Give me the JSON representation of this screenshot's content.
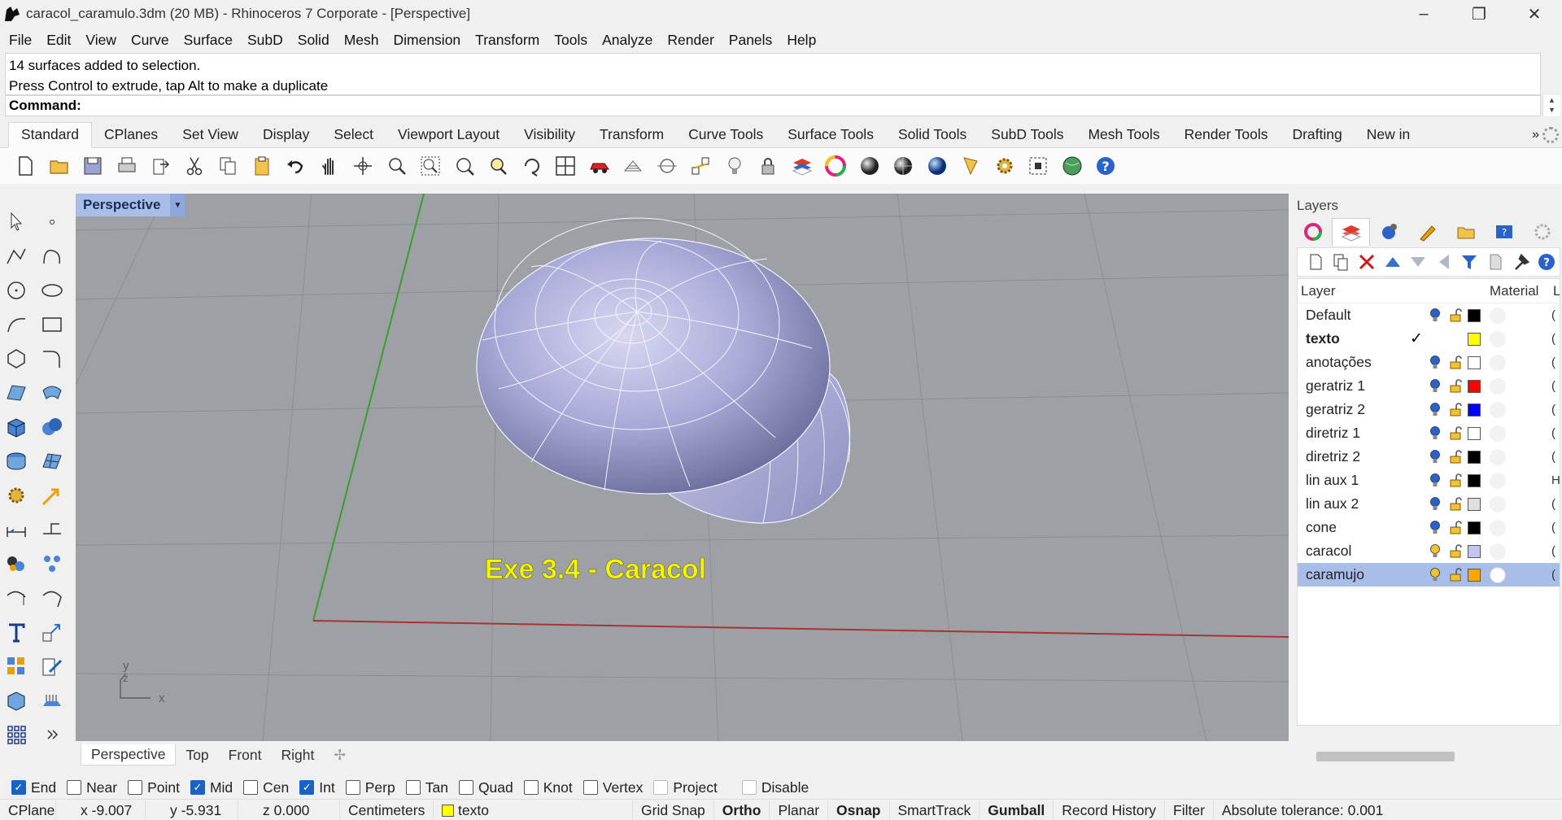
{
  "window": {
    "title": "caracol_caramulo.3dm (20 MB) - Rhinoceros 7 Corporate - [Perspective]",
    "minimize": "–",
    "restore": "❐",
    "close": "✕"
  },
  "menu": [
    "File",
    "Edit",
    "View",
    "Curve",
    "Surface",
    "SubD",
    "Solid",
    "Mesh",
    "Dimension",
    "Transform",
    "Tools",
    "Analyze",
    "Render",
    "Panels",
    "Help"
  ],
  "command": {
    "history": [
      "14 surfaces added to selection.",
      "Press Control to extrude, tap Alt to make a duplicate"
    ],
    "prompt": "Command:"
  },
  "toolbar_tabs": [
    "Standard",
    "CPlanes",
    "Set View",
    "Display",
    "Select",
    "Viewport Layout",
    "Visibility",
    "Transform",
    "Curve Tools",
    "Surface Tools",
    "Solid Tools",
    "SubD Tools",
    "Mesh Tools",
    "Render Tools",
    "Drafting",
    "New in"
  ],
  "toolbar_more": "»",
  "viewport": {
    "name": "Perspective",
    "dropdown": "▼",
    "annotation_text": "Exe 3.4 - Caracol",
    "axis_x": "x",
    "axis_y": "y",
    "axis_z": "z",
    "annotation_color": "#f5f500",
    "shell_color": "#a9a9d8"
  },
  "viewport_tabs": [
    "Perspective",
    "Top",
    "Front",
    "Right"
  ],
  "viewport_tab_add": "✢",
  "layers_panel": {
    "title": "Layers",
    "columns": {
      "layer": "Layer",
      "material": "Material",
      "extra": "L"
    },
    "rows": [
      {
        "name": "Default",
        "current": false,
        "color": "#000000",
        "bulb": "on",
        "end": "("
      },
      {
        "name": "texto",
        "current": true,
        "color": "#ffff00",
        "bulb": "none",
        "end": "("
      },
      {
        "name": "anotações",
        "current": false,
        "color": "#ffffff",
        "bulb": "on",
        "end": "("
      },
      {
        "name": "geratriz 1",
        "current": false,
        "color": "#ff0000",
        "bulb": "on",
        "end": "("
      },
      {
        "name": "geratriz 2",
        "current": false,
        "color": "#0000ff",
        "bulb": "on",
        "end": "("
      },
      {
        "name": "diretriz 1",
        "current": false,
        "color": "#ffffff",
        "bulb": "on",
        "end": "("
      },
      {
        "name": "diretriz 2",
        "current": false,
        "color": "#000000",
        "bulb": "on",
        "end": "("
      },
      {
        "name": "lin aux 1",
        "current": false,
        "color": "#000000",
        "bulb": "on",
        "end": "H"
      },
      {
        "name": "lin aux 2",
        "current": false,
        "color": "#e0e0e0",
        "bulb": "on",
        "end": "("
      },
      {
        "name": "cone",
        "current": false,
        "color": "#000000",
        "bulb": "on",
        "end": "("
      },
      {
        "name": "caracol",
        "current": false,
        "color": "#c4c4f4",
        "bulb": "off",
        "end": "("
      },
      {
        "name": "caramujo",
        "current": false,
        "color": "#ffa500",
        "bulb": "off",
        "end": "(",
        "selected": true,
        "material": "white"
      }
    ],
    "current_mark": "✓"
  },
  "osnap": [
    {
      "label": "End",
      "checked": true
    },
    {
      "label": "Near",
      "checked": false
    },
    {
      "label": "Point",
      "checked": false
    },
    {
      "label": "Mid",
      "checked": true
    },
    {
      "label": "Cen",
      "checked": false
    },
    {
      "label": "Int",
      "checked": true
    },
    {
      "label": "Perp",
      "checked": false
    },
    {
      "label": "Tan",
      "checked": false
    },
    {
      "label": "Quad",
      "checked": false
    },
    {
      "label": "Knot",
      "checked": false
    },
    {
      "label": "Vertex",
      "checked": false
    },
    {
      "label": "Project",
      "checked": false,
      "disabled": true
    },
    {
      "label": "Disable",
      "checked": false,
      "disabled": true
    }
  ],
  "status": {
    "cplane": "CPlane",
    "x": "x -9.007",
    "y": "y -5.931",
    "z": "z 0.000",
    "units": "Centimeters",
    "layer": "texto",
    "layer_color": "#ffff00",
    "grid_snap": "Grid Snap",
    "ortho": "Ortho",
    "planar": "Planar",
    "osnap": "Osnap",
    "smarttrack": "SmartTrack",
    "gumball": "Gumball",
    "record_history": "Record History",
    "filter": "Filter",
    "tolerance": "Absolute tolerance: 0.001"
  },
  "icons": {
    "toolbar": [
      "new-file-icon",
      "open-file-icon",
      "save-icon",
      "print-icon",
      "export-icon",
      "cut-icon",
      "copy-icon",
      "paste-icon",
      "undo-icon",
      "pan-hand-icon",
      "rotate-view-icon",
      "zoom-dynamic-icon",
      "zoom-window-icon",
      "zoom-extents-icon",
      "zoom-selected-icon",
      "rotate-camera-icon",
      "four-viewports-icon",
      "car-icon",
      "grid-icon",
      "snap-icon",
      "osnap-icon",
      "light-icon",
      "lock-icon",
      "layer-icon",
      "color-wheel-icon",
      "wireframe-ball-icon",
      "shaded-ball-icon",
      "render-ball-icon",
      "paint-icon",
      "settings-gear-icon",
      "match-icon",
      "globe-icon",
      "help-icon"
    ]
  }
}
